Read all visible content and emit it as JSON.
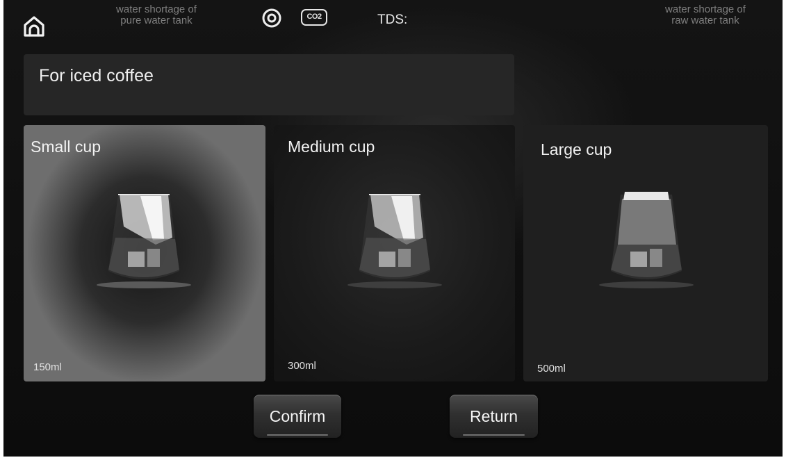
{
  "header": {
    "home_icon": "home-icon",
    "pure_tank_status": "water shortage of\npure water tank",
    "ring_icon": "circle-dot-icon",
    "co2_label": "CO2",
    "tds_label": "TDS:",
    "raw_tank_status": "water shortage of\nraw water tank"
  },
  "title": "For iced coffee",
  "cups": [
    {
      "label": "Small cup",
      "volume": "150ml",
      "selected": true
    },
    {
      "label": "Medium cup",
      "volume": "300ml",
      "selected": false
    },
    {
      "label": "Large cup",
      "volume": "500ml",
      "selected": false
    }
  ],
  "actions": {
    "confirm_label": "Confirm",
    "return_label": "Return"
  }
}
